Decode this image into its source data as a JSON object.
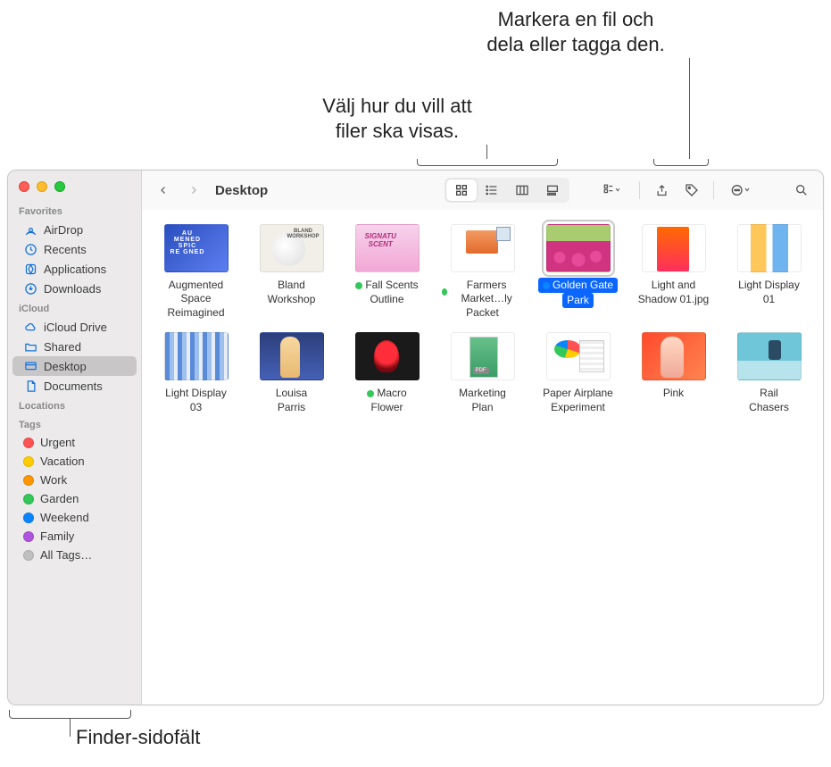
{
  "annotations": {
    "view_callout": "Välj hur du vill att\nfiler ska visas.",
    "share_callout": "Markera en fil och\ndela eller tagga den.",
    "sidebar_callout": "Finder-sidofält"
  },
  "window": {
    "title": "Desktop"
  },
  "toolbar": {
    "back_icon": "chevron-left",
    "forward_icon": "chevron-right",
    "view_modes": [
      "icon",
      "list",
      "column",
      "gallery"
    ],
    "active_view": "icon",
    "group_icon": "group",
    "share_icon": "share",
    "tag_icon": "tag",
    "more_icon": "more",
    "search_icon": "search"
  },
  "sidebar": {
    "sections": [
      {
        "header": "Favorites",
        "items": [
          {
            "icon": "airdrop",
            "label": "AirDrop"
          },
          {
            "icon": "recents",
            "label": "Recents"
          },
          {
            "icon": "applications",
            "label": "Applications"
          },
          {
            "icon": "downloads",
            "label": "Downloads"
          }
        ]
      },
      {
        "header": "iCloud",
        "items": [
          {
            "icon": "icloud",
            "label": "iCloud Drive"
          },
          {
            "icon": "shared",
            "label": "Shared"
          },
          {
            "icon": "desktop",
            "label": "Desktop",
            "selected": true
          },
          {
            "icon": "documents",
            "label": "Documents"
          }
        ]
      },
      {
        "header": "Locations",
        "items": []
      },
      {
        "header": "Tags",
        "items": [
          {
            "color": "red",
            "label": "Urgent"
          },
          {
            "color": "yellow",
            "label": "Vacation"
          },
          {
            "color": "orange",
            "label": "Work"
          },
          {
            "color": "green",
            "label": "Garden"
          },
          {
            "color": "blue",
            "label": "Weekend"
          },
          {
            "color": "purple",
            "label": "Family"
          },
          {
            "color": "gray",
            "label": "All Tags…"
          }
        ]
      }
    ]
  },
  "files": [
    {
      "label": "Augmented Space Reimagined",
      "thumb": "th-a"
    },
    {
      "label": "Bland Workshop",
      "thumb": "th-b"
    },
    {
      "label": "Fall Scents Outline",
      "thumb": "th-c",
      "tag": "green"
    },
    {
      "label": "Farmers Market…ly Packet",
      "thumb": "th-d",
      "tag": "green"
    },
    {
      "label": "Golden Gate Park",
      "thumb": "th-e",
      "tag": "blue",
      "selected": true
    },
    {
      "label": "Light and Shadow 01.jpg",
      "thumb": "th-f"
    },
    {
      "label": "Light Display 01",
      "thumb": "th-g"
    },
    {
      "label": "Light Display 03",
      "thumb": "th-h"
    },
    {
      "label": "Louisa Parris",
      "thumb": "th-i"
    },
    {
      "label": "Macro Flower",
      "thumb": "th-j",
      "tag": "green"
    },
    {
      "label": "Marketing Plan",
      "thumb": "th-k"
    },
    {
      "label": "Paper Airplane Experiment",
      "thumb": "th-l"
    },
    {
      "label": "Pink",
      "thumb": "th-m"
    },
    {
      "label": "Rail Chasers",
      "thumb": "th-n"
    }
  ]
}
